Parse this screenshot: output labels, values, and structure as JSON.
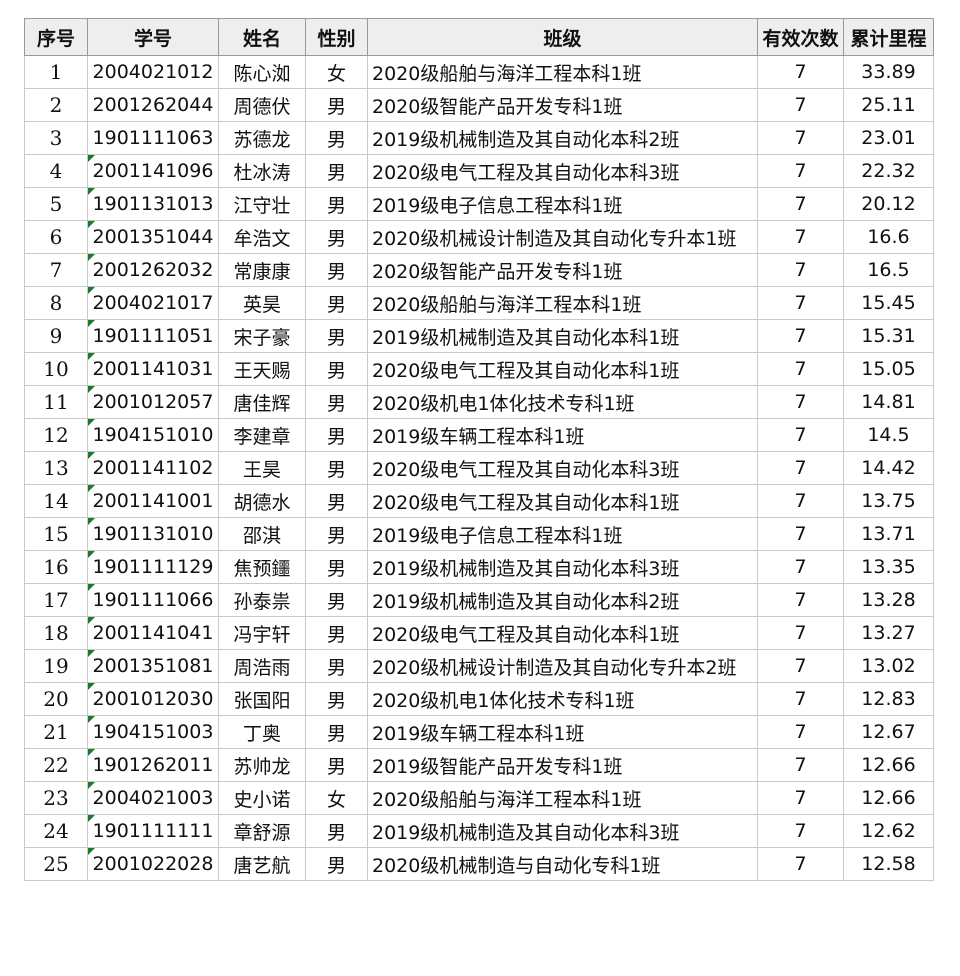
{
  "headers": [
    "序号",
    "学号",
    "姓名",
    "性别",
    "班级",
    "有效次数",
    "累计里程"
  ],
  "rows": [
    {
      "no": "1",
      "id": "2004021012",
      "name": "陈心洳",
      "gender": "女",
      "class": "2020级船舶与海洋工程本科1班",
      "count": "7",
      "miles": "33.89"
    },
    {
      "no": "2",
      "id": "2001262044",
      "name": "周德伏",
      "gender": "男",
      "class": "2020级智能产品开发专科1班",
      "count": "7",
      "miles": "25.11"
    },
    {
      "no": "3",
      "id": "1901111063",
      "name": "苏德龙",
      "gender": "男",
      "class": "2019级机械制造及其自动化本科2班",
      "count": "7",
      "miles": "23.01"
    },
    {
      "no": "4",
      "id": "2001141096",
      "name": "杜冰涛",
      "gender": "男",
      "class": "2020级电气工程及其自动化本科3班",
      "count": "7",
      "miles": "22.32"
    },
    {
      "no": "5",
      "id": "1901131013",
      "name": "江守壮",
      "gender": "男",
      "class": "2019级电子信息工程本科1班",
      "count": "7",
      "miles": "20.12"
    },
    {
      "no": "6",
      "id": "2001351044",
      "name": "牟浩文",
      "gender": "男",
      "class": "2020级机械设计制造及其自动化专升本1班",
      "count": "7",
      "miles": "16.6"
    },
    {
      "no": "7",
      "id": "2001262032",
      "name": "常康康",
      "gender": "男",
      "class": "2020级智能产品开发专科1班",
      "count": "7",
      "miles": "16.5"
    },
    {
      "no": "8",
      "id": "2004021017",
      "name": "英昊",
      "gender": "男",
      "class": "2020级船舶与海洋工程本科1班",
      "count": "7",
      "miles": "15.45"
    },
    {
      "no": "9",
      "id": "1901111051",
      "name": "宋子豪",
      "gender": "男",
      "class": "2019级机械制造及其自动化本科1班",
      "count": "7",
      "miles": "15.31"
    },
    {
      "no": "10",
      "id": "2001141031",
      "name": "王天赐",
      "gender": "男",
      "class": "2020级电气工程及其自动化本科1班",
      "count": "7",
      "miles": "15.05"
    },
    {
      "no": "11",
      "id": "2001012057",
      "name": "唐佳辉",
      "gender": "男",
      "class": "2020级机电1体化技术专科1班",
      "count": "7",
      "miles": "14.81"
    },
    {
      "no": "12",
      "id": "1904151010",
      "name": "李建章",
      "gender": "男",
      "class": "2019级车辆工程本科1班",
      "count": "7",
      "miles": "14.5"
    },
    {
      "no": "13",
      "id": "2001141102",
      "name": "王昊",
      "gender": "男",
      "class": "2020级电气工程及其自动化本科3班",
      "count": "7",
      "miles": "14.42"
    },
    {
      "no": "14",
      "id": "2001141001",
      "name": "胡德水",
      "gender": "男",
      "class": "2020级电气工程及其自动化本科1班",
      "count": "7",
      "miles": "13.75"
    },
    {
      "no": "15",
      "id": "1901131010",
      "name": "邵淇",
      "gender": "男",
      "class": "2019级电子信息工程本科1班",
      "count": "7",
      "miles": "13.71"
    },
    {
      "no": "16",
      "id": "1901111129",
      "name": "焦预鑩",
      "gender": "男",
      "class": "2019级机械制造及其自动化本科3班",
      "count": "7",
      "miles": "13.35"
    },
    {
      "no": "17",
      "id": "1901111066",
      "name": "孙泰祟",
      "gender": "男",
      "class": "2019级机械制造及其自动化本科2班",
      "count": "7",
      "miles": "13.28"
    },
    {
      "no": "18",
      "id": "2001141041",
      "name": "冯宇轩",
      "gender": "男",
      "class": "2020级电气工程及其自动化本科1班",
      "count": "7",
      "miles": "13.27"
    },
    {
      "no": "19",
      "id": "2001351081",
      "name": "周浩雨",
      "gender": "男",
      "class": "2020级机械设计制造及其自动化专升本2班",
      "count": "7",
      "miles": "13.02"
    },
    {
      "no": "20",
      "id": "2001012030",
      "name": "张国阳",
      "gender": "男",
      "class": "2020级机电1体化技术专科1班",
      "count": "7",
      "miles": "12.83"
    },
    {
      "no": "21",
      "id": "1904151003",
      "name": "丁奥",
      "gender": "男",
      "class": "2019级车辆工程本科1班",
      "count": "7",
      "miles": "12.67"
    },
    {
      "no": "22",
      "id": "1901262011",
      "name": "苏帅龙",
      "gender": "男",
      "class": "2019级智能产品开发专科1班",
      "count": "7",
      "miles": "12.66"
    },
    {
      "no": "23",
      "id": "2004021003",
      "name": "史小诺",
      "gender": "女",
      "class": "2020级船舶与海洋工程本科1班",
      "count": "7",
      "miles": "12.66"
    },
    {
      "no": "24",
      "id": "1901111111",
      "name": "章舒源",
      "gender": "男",
      "class": "2019级机械制造及其自动化本科3班",
      "count": "7",
      "miles": "12.62"
    },
    {
      "no": "25",
      "id": "2001022028",
      "name": "唐艺航",
      "gender": "男",
      "class": "2020级机械制造与自动化专科1班",
      "count": "7",
      "miles": "12.58"
    }
  ],
  "flag_color": "#1a7a2a"
}
